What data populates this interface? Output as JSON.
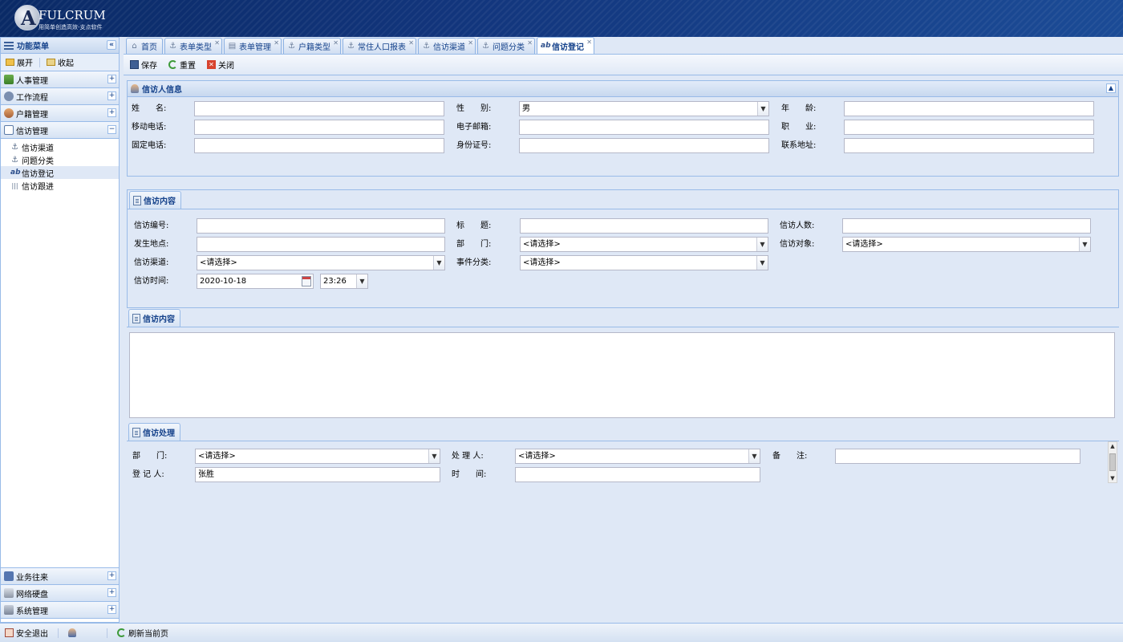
{
  "header": {
    "logo_title": "FULCRUM",
    "logo_subtitle": "用简单创造高效-支点软件"
  },
  "sidebar": {
    "title": "功能菜单",
    "expand_label": "展开",
    "collapse_label": "收起",
    "sections_top": [
      {
        "label": "人事管理",
        "toggle": "+"
      },
      {
        "label": "工作流程",
        "toggle": "+"
      },
      {
        "label": "户籍管理",
        "toggle": "+"
      },
      {
        "label": "信访管理",
        "toggle": "−"
      }
    ],
    "tree_items": [
      {
        "label": "信访渠道",
        "icon": "⚓"
      },
      {
        "label": "问题分类",
        "icon": "⚓"
      },
      {
        "label": "信访登记",
        "icon": "ab"
      },
      {
        "label": "信访跟进",
        "icon": "|||"
      }
    ],
    "sections_bottom": [
      {
        "label": "业务往来",
        "toggle": "+"
      },
      {
        "label": "网络硬盘",
        "toggle": "+"
      },
      {
        "label": "系统管理",
        "toggle": "+"
      }
    ]
  },
  "tabs": [
    {
      "label": "首页",
      "icon": "⌂",
      "closable": false
    },
    {
      "label": "表单类型",
      "icon": "⚓",
      "closable": true
    },
    {
      "label": "表单管理",
      "icon": "▤",
      "closable": true
    },
    {
      "label": "户籍类型",
      "icon": "⚓",
      "closable": true
    },
    {
      "label": "常住人口报表",
      "icon": "⚓",
      "closable": true
    },
    {
      "label": "信访渠道",
      "icon": "⚓",
      "closable": true
    },
    {
      "label": "问题分类",
      "icon": "⚓",
      "closable": true
    },
    {
      "label": "信访登记",
      "icon": "ab",
      "closable": true,
      "active": true
    }
  ],
  "toolbar": {
    "save": "保存",
    "reset": "重置",
    "close": "关闭"
  },
  "petitioner": {
    "title": "信访人信息",
    "name_label": "姓　　名:",
    "gender_label": "性　　别:",
    "gender_value": "男",
    "age_label": "年　　龄:",
    "mobile_label": "移动电话:",
    "email_label": "电子邮箱:",
    "job_label": "职　　业:",
    "phone_label": "固定电话:",
    "id_label": "身份证号:",
    "address_label": "联系地址:"
  },
  "content": {
    "title": "信访内容",
    "number_label": "信访编号:",
    "subject_label": "标　　题:",
    "count_label": "信访人数:",
    "place_label": "发生地点:",
    "dept_label": "部　　门:",
    "dept_value": "<请选择>",
    "target_label": "信访对象:",
    "target_value": "<请选择>",
    "channel_label": "信访渠道:",
    "channel_value": "<请选择>",
    "category_label": "事件分类:",
    "category_value": "<请选择>",
    "time_label": "信访时间:",
    "date_value": "2020-10-18",
    "time_value": "23:26"
  },
  "content_text": {
    "title": "信访内容"
  },
  "handling": {
    "title": "信访处理",
    "dept_label": "部　　门:",
    "dept_value": "<请选择>",
    "handler_label": "处 理 人:",
    "handler_value": "<请选择>",
    "remark_label": "备　　注:",
    "registrar_label": "登 记 人:",
    "registrar_value": "张胜",
    "time_label": "时　　间:"
  },
  "statusbar": {
    "logout": "安全退出",
    "refresh": "刷新当前页"
  },
  "colors": {
    "header_bg": "#0a2a66",
    "border": "#99bbe8",
    "panel_bg": "#dfe8f6",
    "title_text": "#15428b"
  }
}
